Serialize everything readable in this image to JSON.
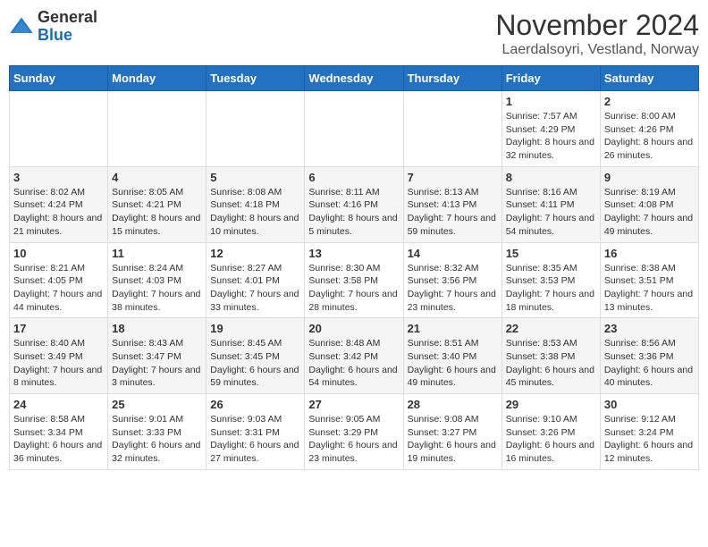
{
  "header": {
    "logo_general": "General",
    "logo_blue": "Blue",
    "month_year": "November 2024",
    "location": "Laerdalsoyri, Vestland, Norway"
  },
  "weekdays": [
    "Sunday",
    "Monday",
    "Tuesday",
    "Wednesday",
    "Thursday",
    "Friday",
    "Saturday"
  ],
  "weeks": [
    [
      {
        "day": "",
        "info": ""
      },
      {
        "day": "",
        "info": ""
      },
      {
        "day": "",
        "info": ""
      },
      {
        "day": "",
        "info": ""
      },
      {
        "day": "",
        "info": ""
      },
      {
        "day": "1",
        "info": "Sunrise: 7:57 AM\nSunset: 4:29 PM\nDaylight: 8 hours and 32 minutes."
      },
      {
        "day": "2",
        "info": "Sunrise: 8:00 AM\nSunset: 4:26 PM\nDaylight: 8 hours and 26 minutes."
      }
    ],
    [
      {
        "day": "3",
        "info": "Sunrise: 8:02 AM\nSunset: 4:24 PM\nDaylight: 8 hours and 21 minutes."
      },
      {
        "day": "4",
        "info": "Sunrise: 8:05 AM\nSunset: 4:21 PM\nDaylight: 8 hours and 15 minutes."
      },
      {
        "day": "5",
        "info": "Sunrise: 8:08 AM\nSunset: 4:18 PM\nDaylight: 8 hours and 10 minutes."
      },
      {
        "day": "6",
        "info": "Sunrise: 8:11 AM\nSunset: 4:16 PM\nDaylight: 8 hours and 5 minutes."
      },
      {
        "day": "7",
        "info": "Sunrise: 8:13 AM\nSunset: 4:13 PM\nDaylight: 7 hours and 59 minutes."
      },
      {
        "day": "8",
        "info": "Sunrise: 8:16 AM\nSunset: 4:11 PM\nDaylight: 7 hours and 54 minutes."
      },
      {
        "day": "9",
        "info": "Sunrise: 8:19 AM\nSunset: 4:08 PM\nDaylight: 7 hours and 49 minutes."
      }
    ],
    [
      {
        "day": "10",
        "info": "Sunrise: 8:21 AM\nSunset: 4:05 PM\nDaylight: 7 hours and 44 minutes."
      },
      {
        "day": "11",
        "info": "Sunrise: 8:24 AM\nSunset: 4:03 PM\nDaylight: 7 hours and 38 minutes."
      },
      {
        "day": "12",
        "info": "Sunrise: 8:27 AM\nSunset: 4:01 PM\nDaylight: 7 hours and 33 minutes."
      },
      {
        "day": "13",
        "info": "Sunrise: 8:30 AM\nSunset: 3:58 PM\nDaylight: 7 hours and 28 minutes."
      },
      {
        "day": "14",
        "info": "Sunrise: 8:32 AM\nSunset: 3:56 PM\nDaylight: 7 hours and 23 minutes."
      },
      {
        "day": "15",
        "info": "Sunrise: 8:35 AM\nSunset: 3:53 PM\nDaylight: 7 hours and 18 minutes."
      },
      {
        "day": "16",
        "info": "Sunrise: 8:38 AM\nSunset: 3:51 PM\nDaylight: 7 hours and 13 minutes."
      }
    ],
    [
      {
        "day": "17",
        "info": "Sunrise: 8:40 AM\nSunset: 3:49 PM\nDaylight: 7 hours and 8 minutes."
      },
      {
        "day": "18",
        "info": "Sunrise: 8:43 AM\nSunset: 3:47 PM\nDaylight: 7 hours and 3 minutes."
      },
      {
        "day": "19",
        "info": "Sunrise: 8:45 AM\nSunset: 3:45 PM\nDaylight: 6 hours and 59 minutes."
      },
      {
        "day": "20",
        "info": "Sunrise: 8:48 AM\nSunset: 3:42 PM\nDaylight: 6 hours and 54 minutes."
      },
      {
        "day": "21",
        "info": "Sunrise: 8:51 AM\nSunset: 3:40 PM\nDaylight: 6 hours and 49 minutes."
      },
      {
        "day": "22",
        "info": "Sunrise: 8:53 AM\nSunset: 3:38 PM\nDaylight: 6 hours and 45 minutes."
      },
      {
        "day": "23",
        "info": "Sunrise: 8:56 AM\nSunset: 3:36 PM\nDaylight: 6 hours and 40 minutes."
      }
    ],
    [
      {
        "day": "24",
        "info": "Sunrise: 8:58 AM\nSunset: 3:34 PM\nDaylight: 6 hours and 36 minutes."
      },
      {
        "day": "25",
        "info": "Sunrise: 9:01 AM\nSunset: 3:33 PM\nDaylight: 6 hours and 32 minutes."
      },
      {
        "day": "26",
        "info": "Sunrise: 9:03 AM\nSunset: 3:31 PM\nDaylight: 6 hours and 27 minutes."
      },
      {
        "day": "27",
        "info": "Sunrise: 9:05 AM\nSunset: 3:29 PM\nDaylight: 6 hours and 23 minutes."
      },
      {
        "day": "28",
        "info": "Sunrise: 9:08 AM\nSunset: 3:27 PM\nDaylight: 6 hours and 19 minutes."
      },
      {
        "day": "29",
        "info": "Sunrise: 9:10 AM\nSunset: 3:26 PM\nDaylight: 6 hours and 16 minutes."
      },
      {
        "day": "30",
        "info": "Sunrise: 9:12 AM\nSunset: 3:24 PM\nDaylight: 6 hours and 12 minutes."
      }
    ]
  ]
}
